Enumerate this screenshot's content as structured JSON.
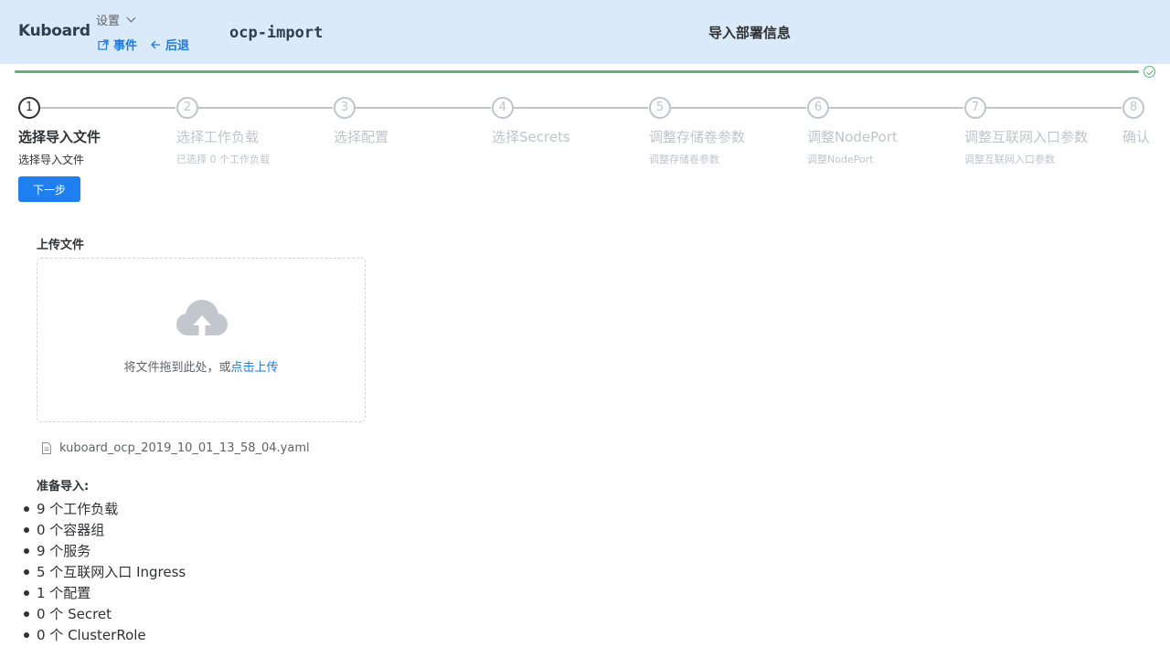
{
  "header": {
    "brand": "Kuboard",
    "settings_label": "设置",
    "events_label": "事件",
    "back_label": "后退",
    "namespace": "ocp-import",
    "page_title": "导入部署信息"
  },
  "steps": [
    {
      "number": "1",
      "title": "选择导入文件",
      "desc": "选择导入文件",
      "active": true
    },
    {
      "number": "2",
      "title": "选择工作负载",
      "desc": "已选择 0 个工作负载",
      "active": false
    },
    {
      "number": "3",
      "title": "选择配置",
      "desc": "",
      "active": false
    },
    {
      "number": "4",
      "title": "选择Secrets",
      "desc": "",
      "active": false
    },
    {
      "number": "5",
      "title": "调整存储卷参数",
      "desc": "调整存储卷参数",
      "active": false
    },
    {
      "number": "6",
      "title": "调整NodePort",
      "desc": "调整NodePort",
      "active": false
    },
    {
      "number": "7",
      "title": "调整互联网入口参数",
      "desc": "调整互联网入口参数",
      "active": false
    },
    {
      "number": "8",
      "title": "确认",
      "desc": "",
      "active": false
    }
  ],
  "next_button": "下一步",
  "upload": {
    "label": "上传文件",
    "drop_text": "将文件拖到此处，或",
    "click_text": "点击上传",
    "file_name": "kuboard_ocp_2019_10_01_13_58_04.yaml"
  },
  "prepare": {
    "label": "准备导入:",
    "items": [
      "9 个工作负载",
      "0 个容器组",
      "9 个服务",
      "5 个互联网入口 Ingress",
      "1 个配置",
      "0 个 Secret",
      "0 个 ClusterRole"
    ]
  },
  "colors": {
    "header_bg": "#dbeafa",
    "accent": "#1e80f0",
    "link": "#1b7be0",
    "progress": "#5bb67d",
    "inactive": "#c0c4cc"
  }
}
